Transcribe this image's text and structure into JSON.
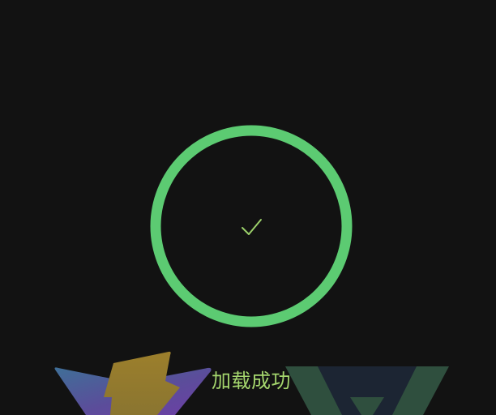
{
  "status": {
    "message": "加载成功",
    "state_icon": "checkmark-icon"
  },
  "logos": {
    "left": "vite-logo",
    "right": "vue-logo"
  },
  "colors": {
    "background": "#121212",
    "ring": "#5ccb72",
    "check": "#9bd06a",
    "text": "#a5d76e"
  }
}
